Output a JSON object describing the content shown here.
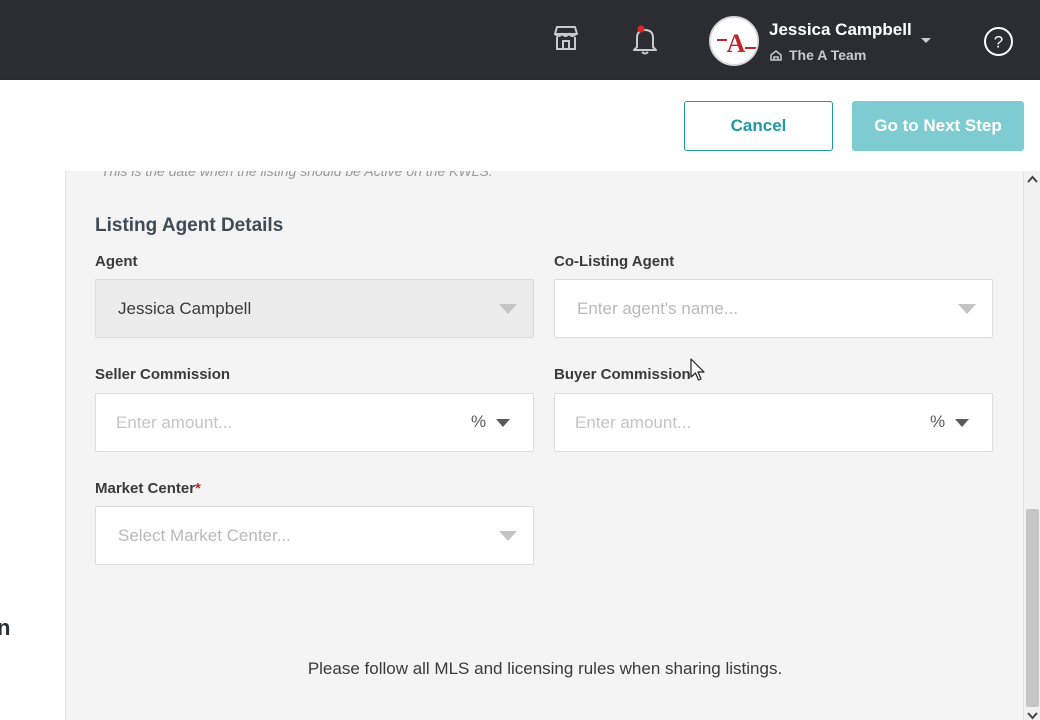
{
  "topbar": {
    "icons": [
      "store-icon",
      "bell-icon",
      "help-icon"
    ],
    "user_name": "Jessica Campbell",
    "team_name": "The A Team",
    "notification_dot_color": "#e0242b"
  },
  "actions": {
    "cancel_label": "Cancel",
    "next_label": "Go to Next Step"
  },
  "form": {
    "active_date_hint": "This is the date when the listing should be Active on the KWLS.",
    "section_title": "Listing Agent Details",
    "agent": {
      "label": "Agent",
      "value": "Jessica Campbell"
    },
    "co_listing_agent": {
      "label": "Co-Listing Agent",
      "placeholder": "Enter agent's name..."
    },
    "seller_commission": {
      "label": "Seller Commission",
      "placeholder": "Enter amount...",
      "unit": "%"
    },
    "buyer_commission": {
      "label": "Buyer Commission",
      "placeholder": "Enter amount...",
      "unit": "%"
    },
    "market_center": {
      "label": "Market Center",
      "required_mark": "*",
      "placeholder": "Select Market Center..."
    }
  },
  "footer_note": "Please follow all MLS and licensing rules when sharing listings.",
  "left_fragment": "n",
  "colors": {
    "topbar_bg": "#2b2d33",
    "accent": "#1e9aa4",
    "accent_disabled": "#7ecbd2",
    "required": "#c0262c"
  }
}
